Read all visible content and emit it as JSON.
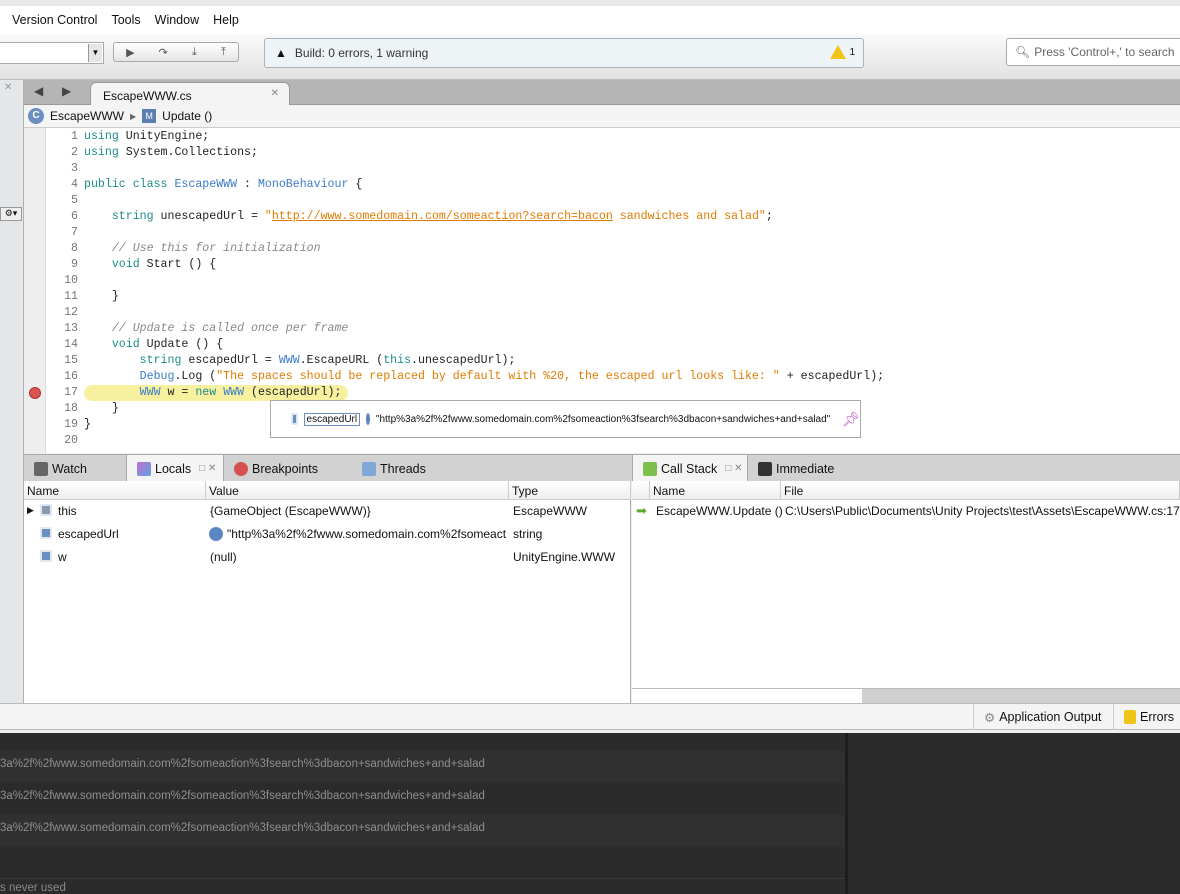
{
  "menu": [
    "Version Control",
    "Tools",
    "Window",
    "Help"
  ],
  "toolbar": {
    "build_status": "Build: 0 errors, 1 warning",
    "warning_count": "1",
    "search_placeholder": "Press 'Control+,' to search"
  },
  "editor": {
    "tab": "EscapeWWW.cs",
    "breadcrumb_class": "EscapeWWW",
    "breadcrumb_method": "Update ()",
    "current_line": 17,
    "lines": [
      [
        [
          "kw",
          "using"
        ],
        [
          "tx",
          " UnityEngine;"
        ]
      ],
      [
        [
          "kw",
          "using"
        ],
        [
          "tx",
          " System.Collections;"
        ]
      ],
      [],
      [
        [
          "kw",
          "public class"
        ],
        [
          "tx",
          " "
        ],
        [
          "ty",
          "EscapeWWW"
        ],
        [
          "tx",
          " : "
        ],
        [
          "ty",
          "MonoBehaviour"
        ],
        [
          "tx",
          " {"
        ]
      ],
      [],
      [
        [
          "tx",
          "    "
        ],
        [
          "kw",
          "string"
        ],
        [
          "tx",
          " unescapedUrl = "
        ],
        [
          "st",
          "\""
        ],
        [
          "url",
          "http://www.somedomain.com/someaction?search=bacon"
        ],
        [
          "st",
          " sandwiches and salad\""
        ],
        [
          "tx",
          ";"
        ]
      ],
      [],
      [
        [
          "tx",
          "    "
        ],
        [
          "cm",
          "// Use this for initialization"
        ]
      ],
      [
        [
          "tx",
          "    "
        ],
        [
          "kw",
          "void"
        ],
        [
          "tx",
          " Start () {"
        ]
      ],
      [],
      [
        [
          "tx",
          "    }"
        ]
      ],
      [],
      [
        [
          "tx",
          "    "
        ],
        [
          "cm",
          "// Update is called once per frame"
        ]
      ],
      [
        [
          "tx",
          "    "
        ],
        [
          "kw",
          "void"
        ],
        [
          "tx",
          " Update () {"
        ]
      ],
      [
        [
          "tx",
          "        "
        ],
        [
          "kw",
          "string"
        ],
        [
          "tx",
          " escapedUrl = "
        ],
        [
          "ty",
          "WWW"
        ],
        [
          "tx",
          ".EscapeURL ("
        ],
        [
          "kw",
          "this"
        ],
        [
          "tx",
          ".unescapedUrl);"
        ]
      ],
      [
        [
          "tx",
          "        "
        ],
        [
          "ty",
          "Debug"
        ],
        [
          "tx",
          ".Log ("
        ],
        [
          "st",
          "\"The spaces should be replaced by default with %20, the escaped url looks like: \""
        ],
        [
          "tx",
          " + escapedUrl);"
        ]
      ],
      [
        [
          "tx",
          "        "
        ],
        [
          "ty",
          "WWW"
        ],
        [
          "tx",
          " w = "
        ],
        [
          "kw",
          "new"
        ],
        [
          "tx",
          " "
        ],
        [
          "ty",
          "WWW"
        ],
        [
          "tx",
          " (escapedUrl);"
        ]
      ],
      [
        [
          "tx",
          "    }"
        ]
      ],
      [
        [
          "tx",
          "}"
        ]
      ],
      []
    ],
    "tooltip": {
      "name": "escapedUrl",
      "value": "\"http%3a%2f%2fwww.somedomain.com%2fsomeaction%3fsearch%3dbacon+sandwiches+and+salad\""
    }
  },
  "pads": {
    "tabs": [
      "Watch",
      "Locals",
      "Breakpoints",
      "Threads"
    ],
    "right_tabs": [
      "Call Stack",
      "Immediate"
    ]
  },
  "locals": {
    "columns": [
      "Name",
      "Value",
      "Type"
    ],
    "rows": [
      {
        "name": "this",
        "value": "{GameObject (EscapeWWW)}",
        "type": "EscapeWWW"
      },
      {
        "name": "escapedUrl",
        "value": "\"http%3a%2f%2fwww.somedomain.com%2fsomeact",
        "type": "string"
      },
      {
        "name": "w",
        "value": "(null)",
        "type": "UnityEngine.WWW"
      }
    ]
  },
  "callstack": {
    "columns": [
      "Name",
      "File"
    ],
    "rows": [
      {
        "name": "EscapeWWW.Update ()",
        "file": "C:\\Users\\Public\\Documents\\Unity Projects\\test\\Assets\\EscapeWWW.cs:17"
      }
    ]
  },
  "status": {
    "app_output": "Application Output",
    "errors": "Errors"
  },
  "output": {
    "rows": [
      "3a%2f%2fwww.somedomain.com%2fsomeaction%3fsearch%3dbacon+sandwiches+and+salad",
      "3a%2f%2fwww.somedomain.com%2fsomeaction%3fsearch%3dbacon+sandwiches+and+salad",
      "3a%2f%2fwww.somedomain.com%2fsomeaction%3fsearch%3dbacon+sandwiches+and+salad"
    ],
    "footer": "s never used"
  },
  "colors": {
    "keyword": "#1d8c8c",
    "type": "#3a7bc8",
    "string": "#e07b00",
    "comment": "#888888",
    "current_line": "#f7f19f"
  }
}
